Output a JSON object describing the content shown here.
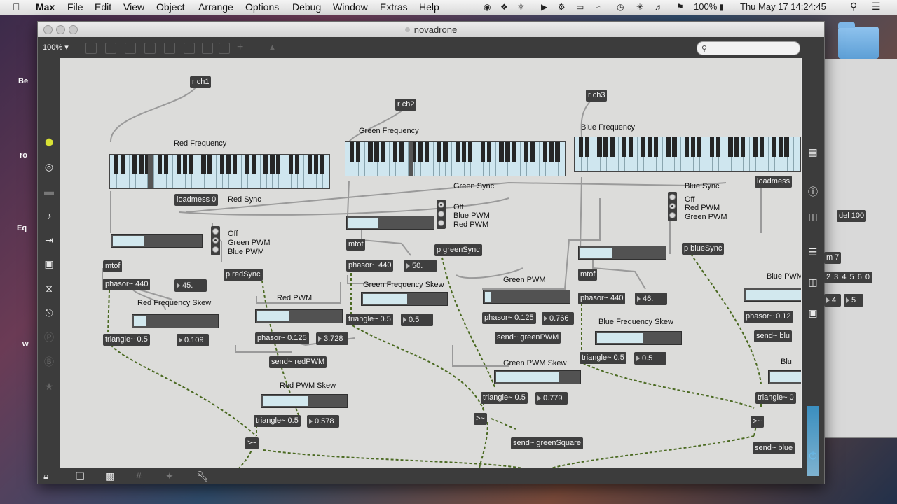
{
  "menubar": {
    "app": "Max",
    "items": [
      "File",
      "Edit",
      "View",
      "Object",
      "Arrange",
      "Options",
      "Debug",
      "Window",
      "Extras",
      "Help"
    ],
    "battery": "100%",
    "clock": "Thu May 17  14:24:45"
  },
  "window": {
    "title": "novadrone",
    "zoom": "100%"
  },
  "side_labels": [
    "Be",
    "ro",
    "Eq",
    "w"
  ],
  "patch": {
    "receives": {
      "ch1": "r ch1",
      "ch2": "r ch2",
      "ch3": "r ch3"
    },
    "comments": {
      "red_freq": "Red Frequency",
      "green_freq": "Green Frequency",
      "blue_freq": "Blue Frequency",
      "red_sync": "Red Sync",
      "green_sync": "Green Sync",
      "blue_sync": "Blue Sync",
      "red_freq_skew": "Red Frequency Skew",
      "green_freq_skew": "Green Frequency Skew",
      "blue_freq_skew": "Blue Frequency Skew",
      "red_pwm": "Red PWM",
      "green_pwm": "Green PWM",
      "blue_pwm": "Blue PWM",
      "red_pwm_skew": "Red PWM Skew",
      "green_pwm_skew": "Green PWM Skew",
      "blue_partial": "Blu"
    },
    "radio_red": [
      "Off",
      "Green PWM",
      "Blue PWM"
    ],
    "radio_green": [
      "Off",
      "Blue PWM",
      "Red PWM"
    ],
    "radio_blue": [
      "Off",
      "Red PWM",
      "Green PWM"
    ],
    "objects": {
      "loadmess0": "loadmess 0",
      "loadmess_right": "loadmess",
      "del": "del 100",
      "m7": "m 7",
      "digits": "2 3 4 5 6 0",
      "mtof_r": "mtof",
      "mtof_g": "mtof",
      "mtof_b": "mtof",
      "phasor_r": "phasor~ 440",
      "phasor_g": "phasor~ 440",
      "phasor_b": "phasor~ 440",
      "tri_r": "triangle~ 0.5",
      "tri_g": "triangle~ 0.5",
      "tri_b": "triangle~ 0.5",
      "p_red": "p redSync",
      "p_green": "p greenSync",
      "p_blue": "p blueSync",
      "phasor_rp": "phasor~ 0.125",
      "phasor_gp": "phasor~ 0.125",
      "phasor_bp": "phasor~ 0.12",
      "send_rpwm": "send~ redPWM",
      "send_gpwm": "send~ greenPWM",
      "send_bpwm": "send~ blu",
      "tri_rp": "triangle~ 0.5",
      "tri_gp": "triangle~ 0.5",
      "tri_bp": "triangle~ 0",
      "cmp_r": ">~",
      "cmp_g": ">~",
      "cmp_b": ">~",
      "send_gsq": "send~ greenSquare",
      "send_bsq": "send~ blue"
    },
    "numbers": {
      "n45": "45.",
      "n109": "0.109",
      "n50": "50.",
      "n05a": "0.5",
      "n46": "46.",
      "n05b": "0.5",
      "n3728": "3.728",
      "n766": "0.766",
      "n578": "0.578",
      "n779": "0.779",
      "n4": "4",
      "n5": "5"
    }
  },
  "slider_levels": {
    "s_r1": 0.35,
    "s_r2": 0.14,
    "s_rp": 0.39,
    "s_rps": 0.54,
    "s_g1": 0.36,
    "s_g2": 0.53,
    "s_gp": 0.07,
    "s_gps": 0.76,
    "s_b1": 0.38,
    "s_b2": 0.56
  }
}
